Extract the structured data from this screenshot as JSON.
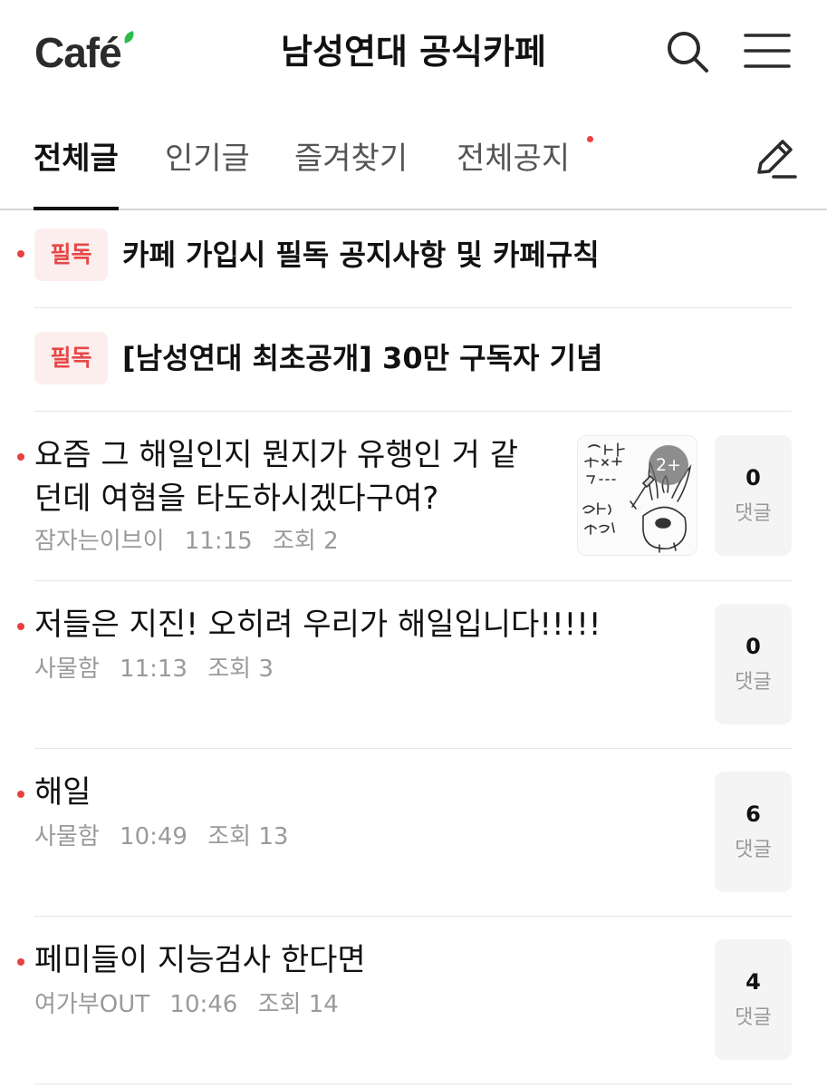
{
  "header": {
    "logo_text": "Café",
    "title": "남성연대 공식카페",
    "search_icon": "search-icon",
    "menu_icon": "hamburger-menu-icon"
  },
  "tabs": [
    {
      "label": "전체글",
      "active": true
    },
    {
      "label": "인기글",
      "active": false
    },
    {
      "label": "즐겨찾기",
      "active": false
    },
    {
      "label": "전체공지",
      "active": false,
      "has_new_dot": true
    }
  ],
  "write_icon": "pencil-icon",
  "notices": [
    {
      "badge": "필독",
      "title": "카페 가입시 필독 공지사항 및 카페규칙",
      "unread": true
    },
    {
      "badge": "필독",
      "title": "[남성연대 최초공개] 30만 구독자 기념",
      "unread": false
    }
  ],
  "posts": [
    {
      "title_line1": "요즘 그 해일인지 뭔지가 유행인 거 같",
      "title_line2": "던데 여혐을 타도하시겠다구여?",
      "author": "잠자는이브이",
      "time": "11:15",
      "views": "조회 2",
      "comments": "0",
      "comment_label": "댓글",
      "thumbnail_count": "2+",
      "unread": true
    },
    {
      "title_line1": "저들은 지진! 오히려 우리가 해일입니다!!!!!",
      "author": "사물함",
      "time": "11:13",
      "views": "조회 3",
      "comments": "0",
      "comment_label": "댓글",
      "unread": true
    },
    {
      "title_line1": "해일",
      "author": "사물함",
      "time": "10:49",
      "views": "조회 13",
      "comments": "6",
      "comment_label": "댓글",
      "unread": true
    },
    {
      "title_line1": "페미들이 지능검사 한다면",
      "author": "여가부OUT",
      "time": "10:46",
      "views": "조회 14",
      "comments": "4",
      "comment_label": "댓글",
      "unread": true
    }
  ],
  "colors": {
    "accent_red": "#e94040",
    "badge_bg": "#fdeeee",
    "logo_leaf": "#2dbb4a"
  }
}
